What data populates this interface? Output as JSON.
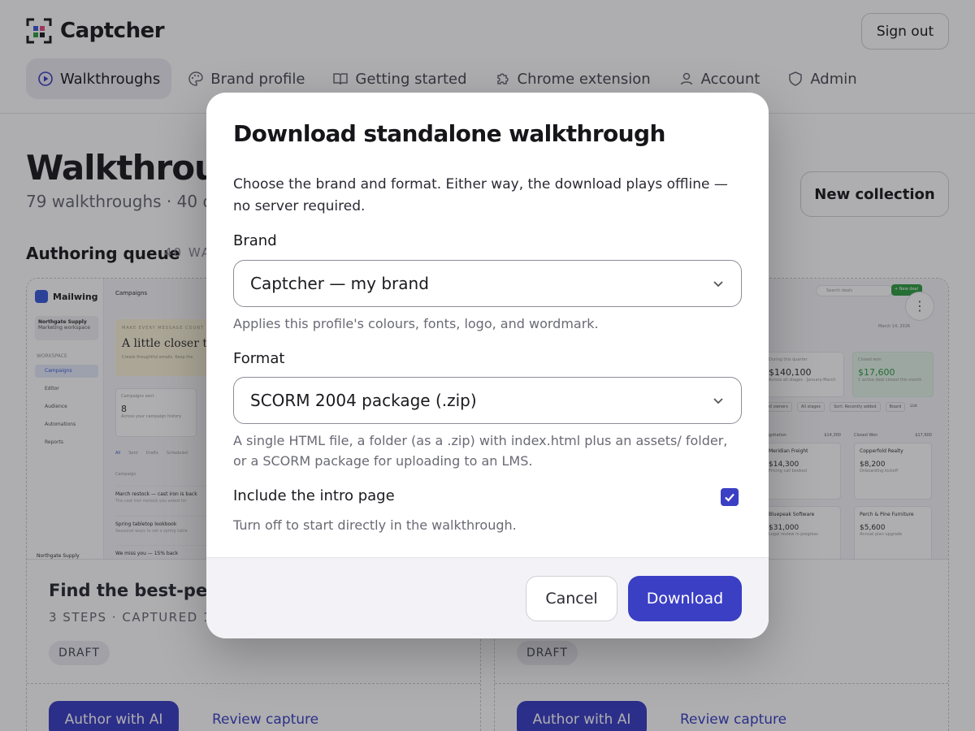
{
  "app": {
    "name": "Captcher",
    "sign_out": "Sign out"
  },
  "nav": [
    {
      "label": "Walkthroughs",
      "icon": "play-circle-icon",
      "active": true
    },
    {
      "label": "Brand profile",
      "icon": "palette-icon",
      "active": false
    },
    {
      "label": "Getting started",
      "icon": "book-icon",
      "active": false
    },
    {
      "label": "Chrome extension",
      "icon": "puzzle-icon",
      "active": false
    },
    {
      "label": "Account",
      "icon": "user-icon",
      "active": false
    },
    {
      "label": "Admin",
      "icon": "shield-icon",
      "active": false
    }
  ],
  "page": {
    "title": "Walkthrough",
    "subtitle": "79 walkthroughs · 40 dra",
    "new_collection": "New collection",
    "section_title": "Authoring queue",
    "section_count": "40 WA"
  },
  "cards": [
    {
      "title": "Find the best-perfor",
      "meta": "3 STEPS · CAPTURED 16H",
      "badge": "DRAFT",
      "author_label": "Author with AI",
      "review_label": "Review capture",
      "preview": {
        "brand": "Mailwing",
        "page": "Campaigns",
        "workspace": "Northgate Supply",
        "workspace_sub": "Marketing workspace",
        "section": "WORKSPACE",
        "links": [
          "Campaigns",
          "Editor",
          "Audience",
          "Automations",
          "Reports"
        ],
        "hero_kicker": "MAKE EVERY MESSAGE COUNT",
        "hero_title": "A little closer to",
        "hero_sub": "Create thoughtful emails. Keep the",
        "stat_label": "Campaigns sent",
        "stat_value": "8",
        "stat_sub": "Across your campaign history",
        "tabs": [
          "All",
          "Sent",
          "Drafts",
          "Scheduled"
        ],
        "table_header": "Campaign",
        "rows": [
          {
            "title": "March restock — cast iron is back",
            "sub": "The cast iron restock you asked for"
          },
          {
            "title": "Spring tabletop lookbook",
            "sub": "Seasonal ways to set a spring table"
          },
          {
            "title": "We miss you — 15% back",
            "sub": ""
          }
        ],
        "footer": "Northgate Supply"
      }
    },
    {
      "title": "",
      "meta": "",
      "badge": "DRAFT",
      "author_label": "Author with AI",
      "review_label": "Review capture",
      "preview": {
        "search": "Search deals",
        "new_deal": "+ New deal",
        "date": "March 14, 2026",
        "stats": [
          {
            "label": "During this quarter",
            "value": "$140,100",
            "sub": "Across all stages · January-March"
          },
          {
            "label": "Closed won",
            "value": "$17,600",
            "sub": "1 active deal closed this month"
          }
        ],
        "filters": [
          "All owners",
          "All stages",
          "Sort: Recently added",
          "Board",
          "List"
        ],
        "columns": [
          {
            "name": "Negotiation",
            "total": "$14,300",
            "cards": [
              {
                "name": "Meridian Freight",
                "value": "$14,300",
                "note": "Pricing call booked"
              },
              {
                "name": "Bluepeak Software",
                "value": "$31,000",
                "note": "Legal review in progress"
              }
            ]
          },
          {
            "name": "Closed Won",
            "total": "$17,600",
            "cards": [
              {
                "name": "Copperfold Realty",
                "value": "$8,200",
                "note": "Onboarding kickoff"
              },
              {
                "name": "Perch & Pine Furniture",
                "value": "$5,600",
                "note": "Annual plan upgrade"
              }
            ]
          }
        ]
      }
    }
  ],
  "modal": {
    "title": "Download standalone walkthrough",
    "description": "Choose the brand and format. Either way, the download plays offline — no server required.",
    "brand_label": "Brand",
    "brand_value": "Captcher — my brand",
    "brand_help": "Applies this profile's colours, fonts, logo, and wordmark.",
    "format_label": "Format",
    "format_value": "SCORM 2004 package (.zip)",
    "format_help": "A single HTML file, a folder (as a .zip) with index.html plus an assets/ folder, or a SCORM package for uploading to an LMS.",
    "intro_label": "Include the intro page",
    "intro_checked": true,
    "intro_help": "Turn off to start directly in the walkthrough.",
    "cancel": "Cancel",
    "download": "Download"
  },
  "colors": {
    "accent": "#3b3fc4",
    "overlay": "rgba(18,18,24,0.34)"
  }
}
